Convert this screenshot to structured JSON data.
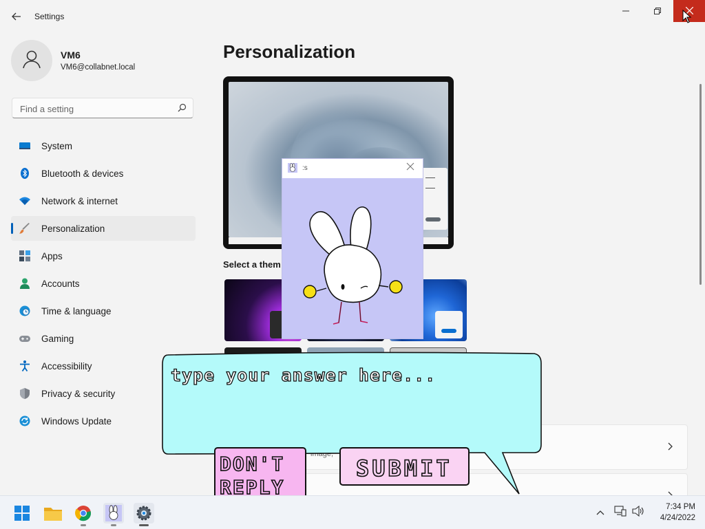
{
  "window": {
    "title": "Settings",
    "back_icon": "back-arrow-icon",
    "minimize_icon": "minimize-icon",
    "maximize_icon": "restore-icon",
    "close_icon": "close-icon",
    "close_color": "#c42b1c"
  },
  "sidebar": {
    "profile": {
      "name": "VM6",
      "email": "VM6@collabnet.local",
      "avatar_icon": "user-icon"
    },
    "search": {
      "placeholder": "Find a setting",
      "icon": "search-icon"
    },
    "items": [
      {
        "label": "System",
        "icon": "system-icon",
        "color": "#0078d4"
      },
      {
        "label": "Bluetooth & devices",
        "icon": "bluetooth-icon",
        "color": "#0078d4"
      },
      {
        "label": "Network & internet",
        "icon": "wifi-icon",
        "color": "#0078d4"
      },
      {
        "label": "Personalization",
        "icon": "brush-icon",
        "color": "#e07c3a",
        "active": true
      },
      {
        "label": "Apps",
        "icon": "apps-icon",
        "color": "#4b5b6b"
      },
      {
        "label": "Accounts",
        "icon": "accounts-icon",
        "color": "#2aa36b"
      },
      {
        "label": "Time & language",
        "icon": "globe-clock-icon",
        "color": "#0a84c6"
      },
      {
        "label": "Gaming",
        "icon": "gamepad-icon",
        "color": "#7a7a7a"
      },
      {
        "label": "Accessibility",
        "icon": "accessibility-icon",
        "color": "#0067c0"
      },
      {
        "label": "Privacy & security",
        "icon": "shield-icon",
        "color": "#6b6b6b"
      },
      {
        "label": "Windows Update",
        "icon": "update-icon",
        "color": "#0a84c6"
      }
    ],
    "accent": "#005fb8"
  },
  "main": {
    "title": "Personalization",
    "themes_label": "Select a them",
    "card_sub": "image,"
  },
  "popup": {
    "title": ":s",
    "close_icon": "close-icon",
    "background": "#c6c6f6"
  },
  "bubble": {
    "placeholder": "type your answer here...",
    "dont_reply_label": "DON'T REPLY",
    "submit_label": "SUBMIT",
    "bubble_color": "#b4fafa",
    "button_color": "#f7b6f0"
  },
  "taskbar": {
    "icons": [
      "windows-start-icon",
      "file-explorer-icon",
      "chrome-icon",
      "bunny-app-icon",
      "settings-gear-icon"
    ],
    "tray_icons": [
      "chevron-up-icon",
      "network-icon",
      "volume-icon"
    ],
    "time": "7:34 PM",
    "date": "4/24/2022"
  }
}
